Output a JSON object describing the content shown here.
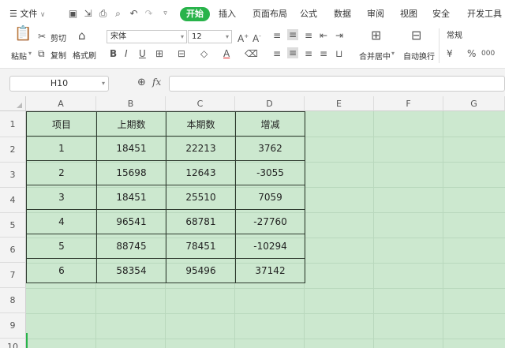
{
  "menubar": {
    "file_label": "文件",
    "tabs": [
      "开始",
      "插入",
      "页面布局",
      "公式",
      "数据",
      "审阅",
      "视图",
      "安全",
      "开发工具"
    ],
    "active_tab": "开始"
  },
  "ribbon": {
    "paste_label": "粘贴",
    "cut_label": "剪切",
    "copy_label": "复制",
    "format_painter_label": "格式刷",
    "font_name": "宋体",
    "font_size": "12",
    "merge_center_label": "合并居中",
    "wrap_text_label": "自动换行",
    "number_format": "常规"
  },
  "formula_bar": {
    "cell_ref": "H10",
    "fx_label": "fx",
    "formula": ""
  },
  "columns": [
    "A",
    "B",
    "C",
    "D",
    "E",
    "F",
    "G"
  ],
  "rows": [
    "1",
    "2",
    "3",
    "4",
    "5",
    "6",
    "7",
    "8",
    "9",
    "10"
  ],
  "table": {
    "headers": [
      "项目",
      "上期数",
      "本期数",
      "增减"
    ],
    "rows": [
      [
        "1",
        "18451",
        "22213",
        "3762"
      ],
      [
        "2",
        "15698",
        "12643",
        "-3055"
      ],
      [
        "3",
        "18451",
        "25510",
        "7059"
      ],
      [
        "4",
        "96541",
        "68781",
        "-27760"
      ],
      [
        "5",
        "88745",
        "78451",
        "-10294"
      ],
      [
        "6",
        "58354",
        "95496",
        "37142"
      ]
    ]
  },
  "colors": {
    "accent": "#28b34a",
    "sheet_background": "#cce8cf",
    "header_background": "#f3f3f3"
  }
}
